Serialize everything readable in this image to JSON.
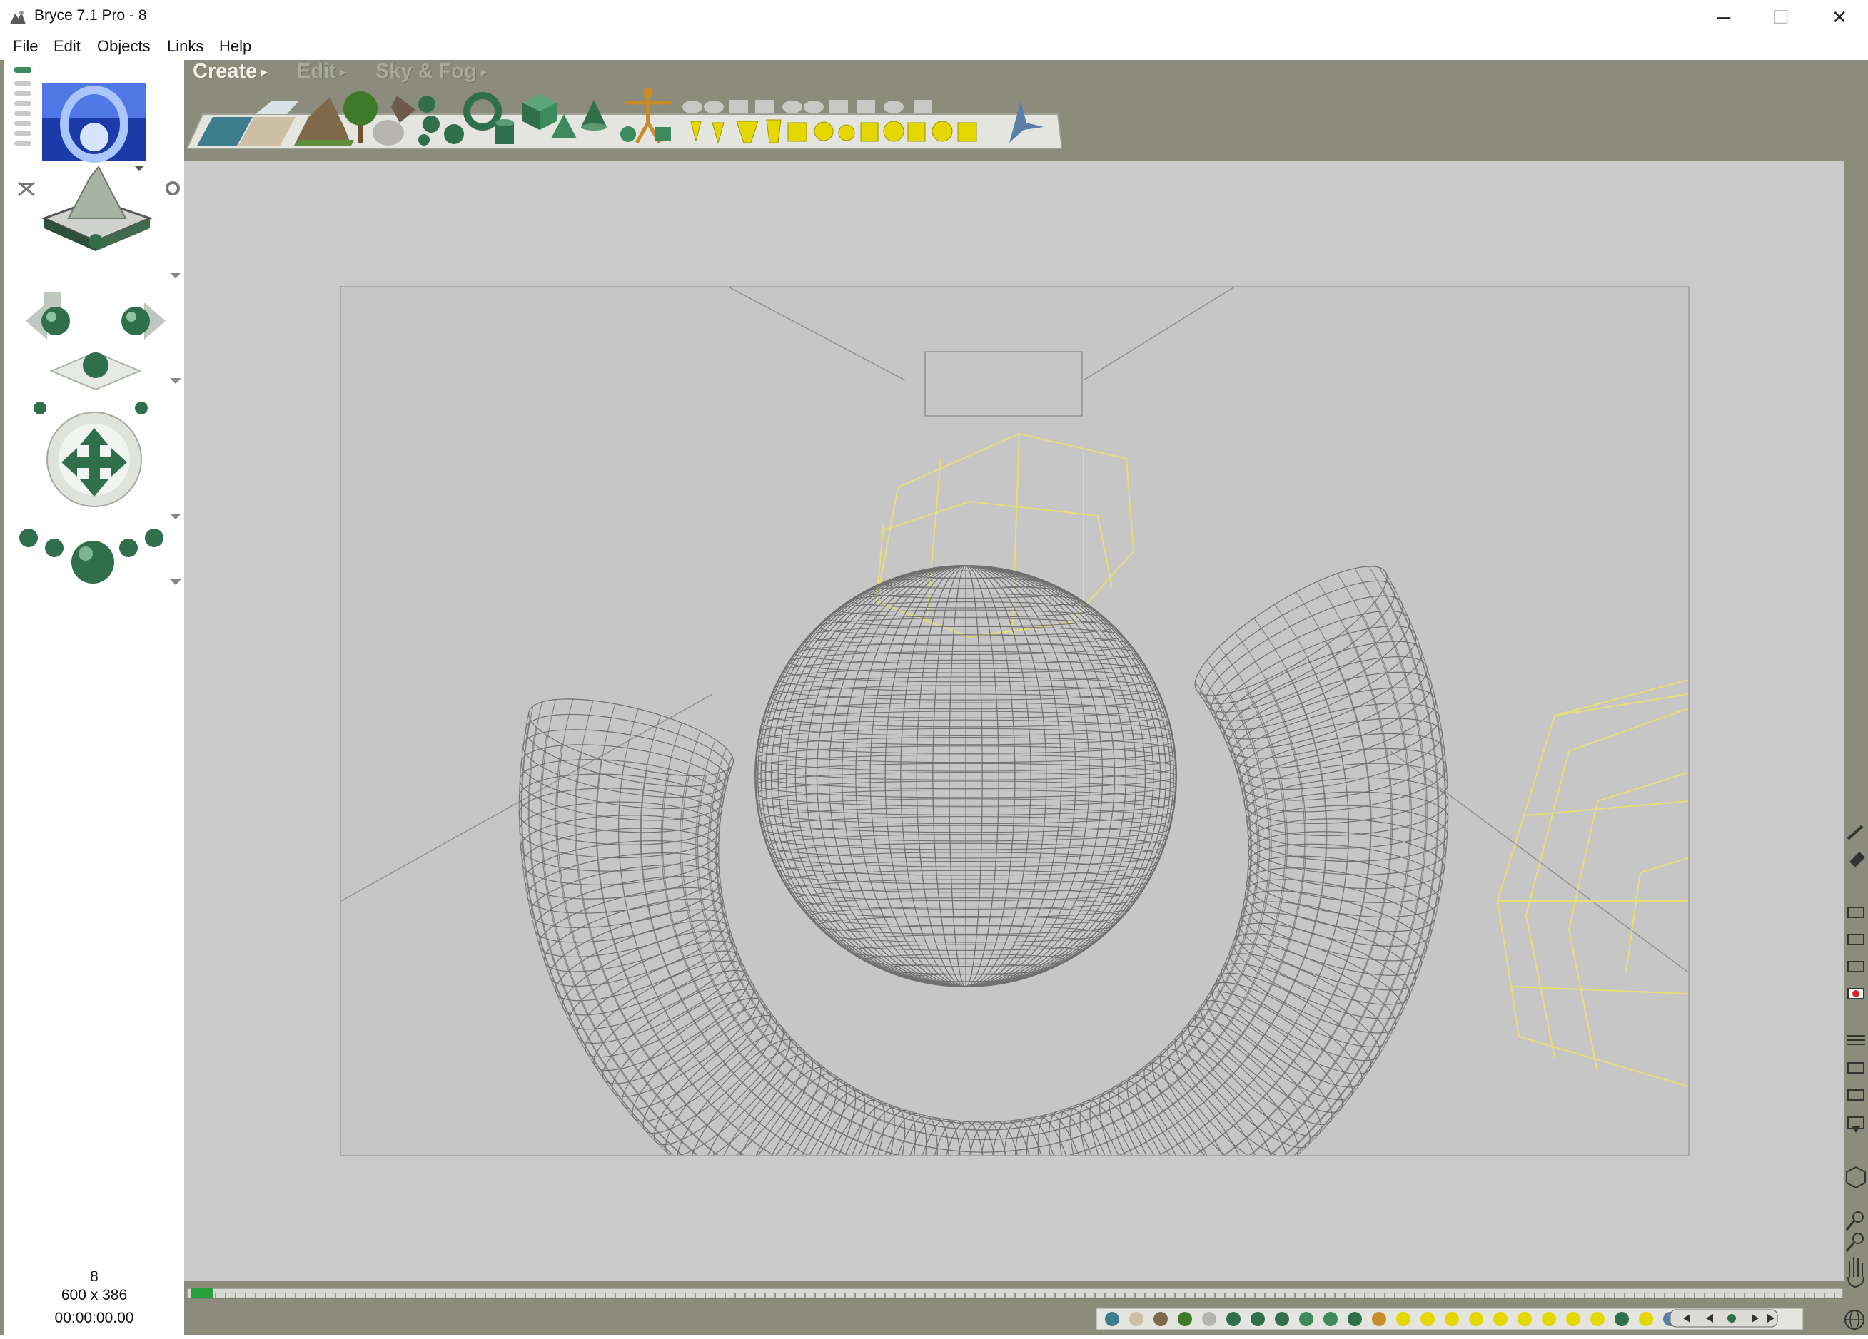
{
  "window": {
    "title": "Bryce 7.1  Pro - 8",
    "min_glyph": "─",
    "max_glyph": "☐",
    "close_glyph": "✕"
  },
  "menu": {
    "items": [
      "File",
      "Edit",
      "Objects",
      "Links",
      "Help"
    ]
  },
  "tool_tabs": {
    "create": "Create",
    "edit": "Edit",
    "sky_fog": "Sky & Fog",
    "arrow": "▸"
  },
  "status": {
    "document": "8",
    "size": "600 x 386",
    "time": "00:00:00.00"
  },
  "colors": {
    "workspace": "#8b8c7c",
    "document": "#cacaca",
    "viewport": "#c6c6c6",
    "wireframe": "#6f6f6f",
    "wireframe_selected": "#e6df74",
    "accent_green": "#2f6f4b",
    "accent_yellow": "#e4d800"
  },
  "icons": {
    "create_objects": [
      "water-plane-icon",
      "infinite-plane-icon",
      "terrain-icon",
      "tree-icon",
      "rock-icon",
      "symmetrical-lattice-icon",
      "metaball-icon",
      "torus-icon",
      "cylinder-icon",
      "cube-icon",
      "pyramid-icon",
      "cone-icon",
      "human-figure-icon",
      "light-icon",
      "camera-icon"
    ],
    "nav": [
      "view-control-icon",
      "trackball-icon",
      "pan-arrows-icon",
      "zoom-icon"
    ]
  }
}
